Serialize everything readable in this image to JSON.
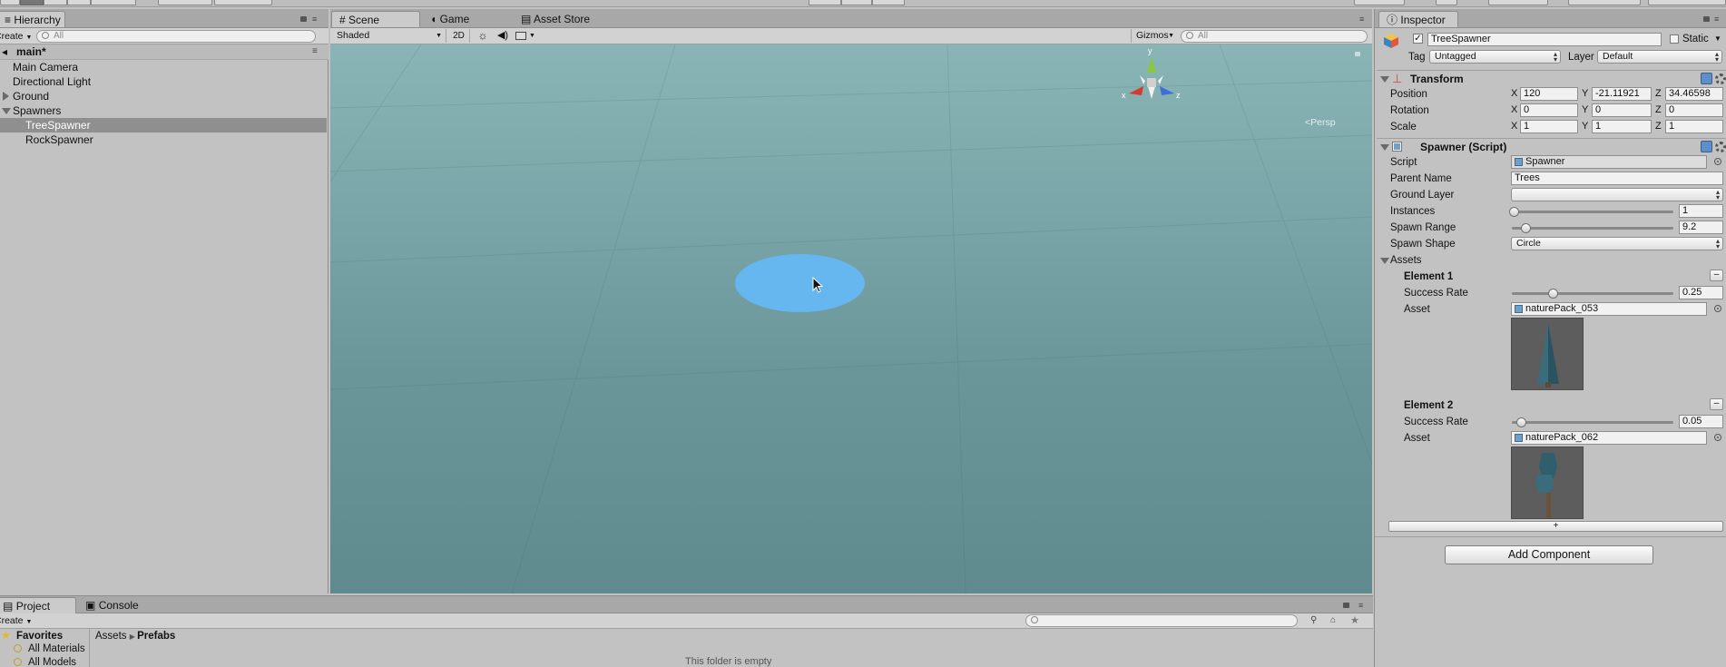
{
  "hierarchy": {
    "tab_label": "Hierarchy",
    "create_label": "Create",
    "search_placeholder": "All",
    "scene_name": "main*",
    "items": [
      {
        "label": "Main Camera"
      },
      {
        "label": "Directional Light"
      },
      {
        "label": "Ground"
      },
      {
        "label": "Spawners"
      },
      {
        "label": "TreeSpawner"
      },
      {
        "label": "RockSpawner"
      }
    ]
  },
  "scene_view": {
    "tabs": [
      "Scene",
      "Game",
      "Asset Store"
    ],
    "shading_mode": "Shaded",
    "mode_2d": "2D",
    "gizmos_label": "Gizmos",
    "search_placeholder": "All",
    "persp_label": "Persp",
    "gizmo_axes": {
      "x": "x",
      "y": "y",
      "z": "z"
    },
    "colors": {
      "sky": "#86b1b2",
      "ground": "#5f8a8e",
      "spawn_disc": "#66b6ef"
    }
  },
  "inspector": {
    "tab_label": "Inspector",
    "object_name": "TreeSpawner",
    "static_label": "Static",
    "tag_label": "Tag",
    "tag_value": "Untagged",
    "layer_label": "Layer",
    "layer_value": "Default",
    "transform": {
      "title": "Transform",
      "position_label": "Position",
      "rotation_label": "Rotation",
      "scale_label": "Scale",
      "axis_x": "X",
      "axis_y": "Y",
      "axis_z": "Z",
      "position": {
        "x": "120",
        "y": "-21.11921",
        "z": "34.46598"
      },
      "rotation": {
        "x": "0",
        "y": "0",
        "z": "0"
      },
      "scale": {
        "x": "1",
        "y": "1",
        "z": "1"
      }
    },
    "spawner": {
      "title": "Spawner (Script)",
      "script_label": "Script",
      "script_value": "Spawner",
      "parent_name_label": "Parent Name",
      "parent_name_value": "Trees",
      "ground_layer_label": "Ground Layer",
      "ground_layer_value": "",
      "instances_label": "Instances",
      "instances_value": "1",
      "instances_slider_fraction": 0.0,
      "spawn_range_label": "Spawn Range",
      "spawn_range_value": "9.2",
      "spawn_shape_label": "Spawn Shape",
      "spawn_shape_value": "Circle",
      "assets_label": "Assets",
      "elements": [
        {
          "title": "Element 1",
          "success_rate_label": "Success Rate",
          "success_rate": "0.25",
          "asset_label": "Asset",
          "asset_value": "naturePack_053"
        },
        {
          "title": "Element 2",
          "success_rate_label": "Success Rate",
          "success_rate": "0.05",
          "asset_label": "Asset",
          "asset_value": "naturePack_062"
        }
      ],
      "add_element_label": "+"
    },
    "add_component_label": "Add Component"
  },
  "project": {
    "tabs": [
      "Project",
      "Console"
    ],
    "create_label": "Create",
    "favorites_label": "Favorites",
    "favorites": [
      "All Materials",
      "All Models"
    ],
    "breadcrumb": [
      "Assets",
      "Prefabs"
    ],
    "empty_message": "This folder is empty"
  }
}
